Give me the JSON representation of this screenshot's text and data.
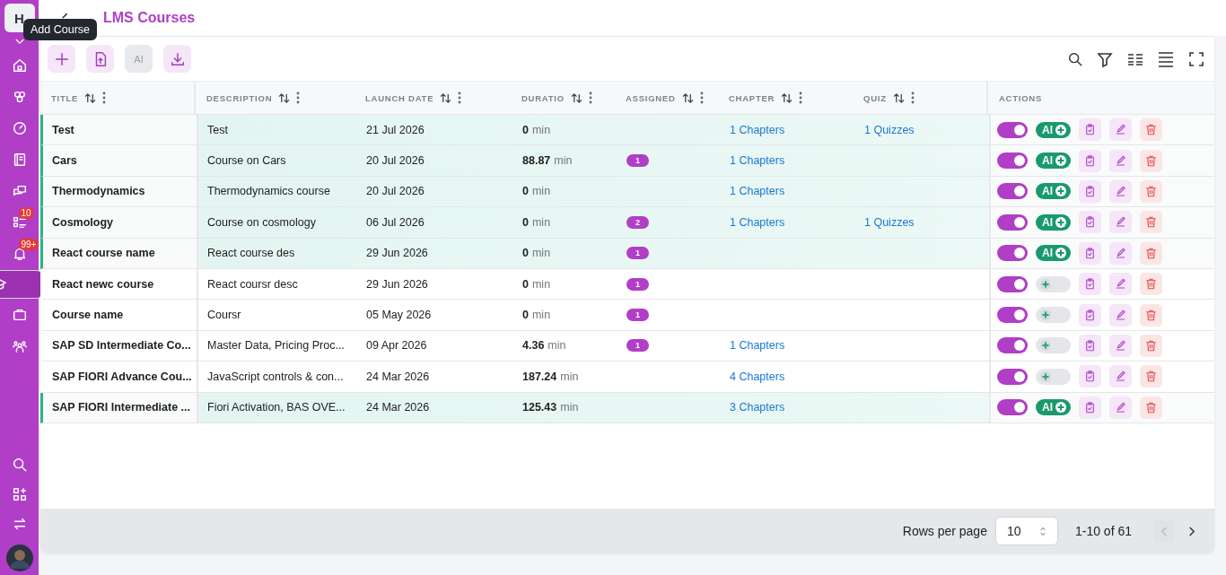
{
  "sidebar": {
    "logo": "H",
    "items": [
      {
        "selected": false
      },
      {
        "selected": false
      },
      {
        "selected": false
      },
      {
        "selected": false
      },
      {
        "selected": false
      },
      {
        "selected": false,
        "badge": "10"
      },
      {
        "selected": false,
        "badge": "99+"
      },
      {
        "selected": true
      },
      {
        "selected": false
      },
      {
        "selected": false
      }
    ]
  },
  "tooltip": "Add Course",
  "page_title": "LMS Courses",
  "toolbar": [
    {
      "disabled": false
    },
    {
      "disabled": false
    },
    {
      "label": "AI",
      "disabled": true
    },
    {
      "disabled": false
    }
  ],
  "columns": [
    "TITLE",
    "DESCRIPTION",
    "LAUNCH DATE",
    "DURATIO",
    "ASSIGNED",
    "CHAPTER",
    "QUIZ",
    "ACTIONS"
  ],
  "rows": [
    {
      "title": "Test",
      "description": "Test",
      "launch_date": "21 Jul 2026",
      "duration": "0",
      "unit": "min",
      "chapters": "1 Chapters",
      "quizzes": "1 Quizzes",
      "highlighted": true,
      "active": true,
      "ai": true,
      "ai_label": "AI"
    },
    {
      "title": "Cars",
      "description": "Course on Cars",
      "launch_date": "20 Jul 2026",
      "duration": "88.87",
      "unit": "min",
      "assigned": "1",
      "chapters": "1 Chapters",
      "highlighted": true,
      "active": true,
      "ai": true,
      "ai_label": "AI"
    },
    {
      "title": "Thermodynamics",
      "description": "Thermodynamics course",
      "launch_date": "20 Jul 2026",
      "duration": "0",
      "unit": "min",
      "chapters": "1 Chapters",
      "highlighted": true,
      "active": true,
      "ai": true,
      "ai_label": "AI"
    },
    {
      "title": "Cosmology",
      "description": "Course on cosmology",
      "launch_date": "06 Jul 2026",
      "duration": "0",
      "unit": "min",
      "assigned": "2",
      "chapters": "1 Chapters",
      "quizzes": "1 Quizzes",
      "highlighted": true,
      "active": true,
      "ai": true,
      "ai_label": "AI"
    },
    {
      "title": "React course name",
      "description": "React course des",
      "launch_date": "29 Jun 2026",
      "duration": "0",
      "unit": "min",
      "assigned": "1",
      "highlighted": true,
      "active": true,
      "ai": true,
      "ai_label": "AI"
    },
    {
      "title": "React newc course",
      "description": "React coursr desc",
      "launch_date": "29 Jun 2026",
      "duration": "0",
      "unit": "min",
      "assigned": "1",
      "highlighted": false,
      "active": true,
      "ai": false
    },
    {
      "title": "Course name",
      "description": "Coursr",
      "launch_date": "05 May 2026",
      "duration": "0",
      "unit": "min",
      "assigned": "1",
      "highlighted": false,
      "active": true,
      "ai": false
    },
    {
      "title": "SAP SD Intermediate Co...",
      "description": "Master Data, Pricing Proc...",
      "launch_date": "09 Apr 2026",
      "duration": "4.36",
      "unit": "min",
      "assigned": "1",
      "chapters": "1 Chapters",
      "highlighted": false,
      "active": true,
      "ai": false
    },
    {
      "title": "SAP FIORI Advance Cou...",
      "description": "JavaScript controls & con...",
      "launch_date": "24 Mar 2026",
      "duration": "187.24",
      "unit": "min",
      "chapters": "4 Chapters",
      "highlighted": false,
      "active": true,
      "ai": false
    },
    {
      "title": "SAP FIORI Intermediate ...",
      "description": "Fiori Activation, BAS OVE...",
      "launch_date": "24 Mar 2026",
      "duration": "125.43",
      "unit": "min",
      "chapters": "3 Chapters",
      "highlighted": true,
      "active": true,
      "ai": true,
      "ai_label": "AI"
    }
  ],
  "pagination": {
    "rows_label": "Rows per page",
    "rows_per_page": "10",
    "range": "1-10 of 61",
    "prev_disabled": true
  }
}
